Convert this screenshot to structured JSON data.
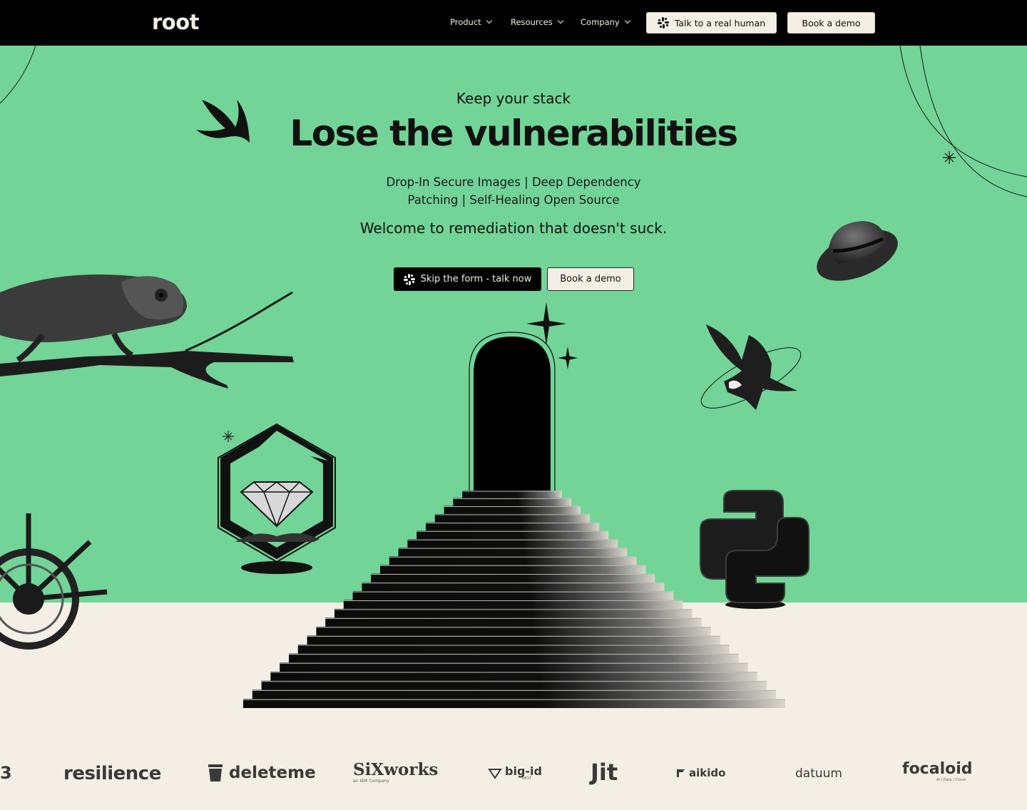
{
  "nav": {
    "logo": "root",
    "menu": [
      {
        "label": "Product"
      },
      {
        "label": "Resources"
      },
      {
        "label": "Company"
      }
    ],
    "talk_label": "Talk to a real human",
    "demo_label": "Book a demo"
  },
  "hero": {
    "kicker": "Keep your stack",
    "title": "Lose the vulnerabilities",
    "subtitle_line1": "Drop-In Secure Images | Deep Dependency",
    "subtitle_line2": "Patching | Self-Healing Open Source",
    "welcome": "Welcome to remediation that doesn't suck.",
    "cta_primary": "Skip the form - talk now",
    "cta_secondary": "Book a demo"
  },
  "logos": {
    "items": [
      "resilience",
      "deleteme",
      "SiXworks",
      "big-id",
      "Jit",
      "aikido",
      "datuum",
      "focaloid"
    ],
    "sixworks_sub": "an IBM Company",
    "bigid_sub": "NEXT",
    "focaloid_sub": "AI | Data | Cloud",
    "partial": "3"
  },
  "colors": {
    "nav_bg": "#000000",
    "hero_bg": "#72d497",
    "page_bg": "#f4efe4",
    "button_bg": "#f4efe4",
    "text": "#111111"
  }
}
